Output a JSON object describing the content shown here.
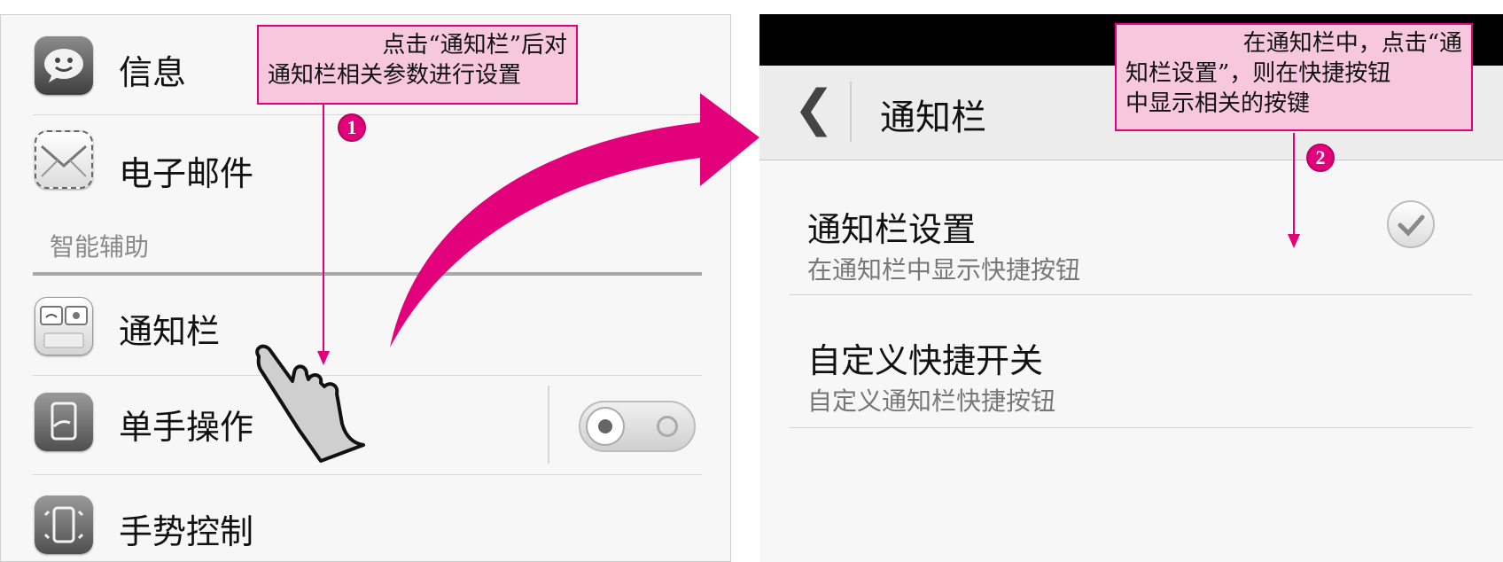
{
  "left": {
    "items": [
      {
        "label": "信息",
        "icon": "message-icon"
      },
      {
        "label": "电子邮件",
        "icon": "email-icon"
      },
      {
        "label": "通知栏",
        "icon": "notification-bar-icon"
      },
      {
        "label": "单手操作",
        "icon": "one-hand-icon"
      },
      {
        "label": "手势控制",
        "icon": "gesture-control-icon"
      }
    ],
    "section_header": "智能辅助",
    "one_hand_toggle_on": false
  },
  "right": {
    "title": "通知栏",
    "back_icon": "chevron-left-icon",
    "settings": [
      {
        "title": "通知栏设置",
        "subtitle": "在通知栏中显示快捷按钮",
        "checked": true
      },
      {
        "title": "自定义快捷开关",
        "subtitle": "自定义通知栏快捷按钮"
      }
    ]
  },
  "callouts": [
    {
      "step": "1",
      "line1": "点击“通知栏”后对",
      "line2": "通知栏相关参数进行设置"
    },
    {
      "step": "2",
      "line1": "在通知栏中，点击“通",
      "line2": "知栏设置”，则在快捷按钮",
      "line3": "中显示相关的按键"
    }
  ],
  "colors": {
    "accent": "#e3007b",
    "callout_bg": "#f7c8dd"
  }
}
